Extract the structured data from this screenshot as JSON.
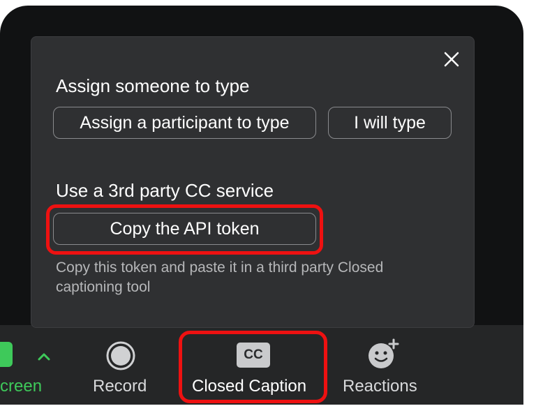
{
  "popup": {
    "section1_title": "Assign someone to type",
    "assign_participant_button": "Assign a participant to type",
    "i_will_type_button": "I will type",
    "section2_title": "Use a 3rd party CC service",
    "copy_token_button": "Copy the API token",
    "hint_text": "Copy this token and paste it in a third party Closed captioning tool",
    "close_icon": "close-icon"
  },
  "toolbar": {
    "share_screen_label": "creen",
    "record_label": "Record",
    "closed_caption_label": "Closed Caption",
    "cc_icon_text": "CC",
    "reactions_label": "Reactions"
  },
  "colors": {
    "highlight": "#ee1111",
    "share_green": "#3ec95a",
    "popup_bg": "#2f3032",
    "toolbar_bg": "#252627"
  }
}
